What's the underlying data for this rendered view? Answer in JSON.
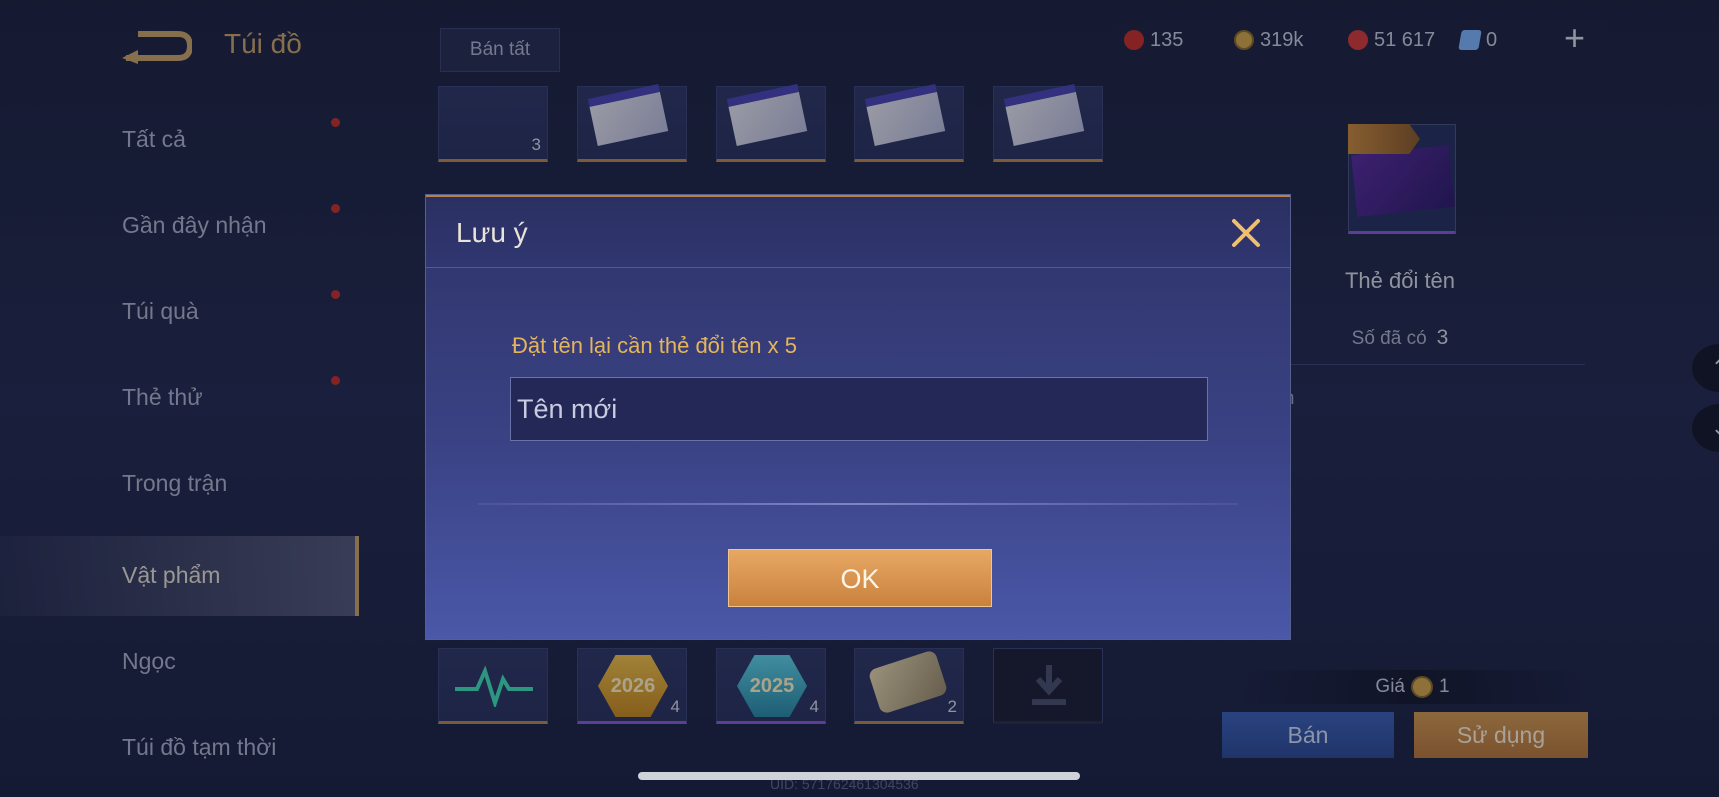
{
  "header": {
    "title": "Túi đồ",
    "sell_all_label": "Bán tất",
    "currencies": [
      {
        "icon": "red-gem-icon",
        "value": "135",
        "color": "#c8302c"
      },
      {
        "icon": "gold-coin-icon",
        "value": "319k",
        "color": "#d4a84a"
      },
      {
        "icon": "red-voucher-icon",
        "value": "51 617",
        "color": "#d63a3a"
      },
      {
        "icon": "blue-ticket-icon",
        "value": "0",
        "color": "#7fb6ff"
      }
    ],
    "plus_label": "+"
  },
  "sidebar": {
    "items": [
      {
        "label": "Tất cả",
        "has_dot": true
      },
      {
        "label": "Gần đây nhận",
        "has_dot": true
      },
      {
        "label": "Túi quà",
        "has_dot": true
      },
      {
        "label": "Thẻ thử",
        "has_dot": true
      },
      {
        "label": "Trong trận",
        "has_dot": false
      },
      {
        "label": "Vật phẩm",
        "has_dot": false,
        "active": true
      },
      {
        "label": "Ngọc",
        "has_dot": false
      },
      {
        "label": "Túi đồ tạm thời",
        "has_dot": false
      }
    ]
  },
  "grid": {
    "row1_first_qty": "3",
    "row_bottom": [
      {
        "name": "heartbeat-item",
        "qty": ""
      },
      {
        "name": "badge-2026",
        "label": "2026",
        "qty": "4"
      },
      {
        "name": "badge-2025",
        "label": "2025",
        "qty": "4"
      },
      {
        "name": "scroll-item",
        "qty": "2"
      },
      {
        "name": "download-slot",
        "qty": ""
      }
    ]
  },
  "detail": {
    "item_name": "Thẻ đổi tên",
    "owned_label": "Số đã có",
    "owned_value": "3",
    "desc_fragment": "tên",
    "price_label": "Giá",
    "price_value": "1",
    "sell_label": "Bán",
    "use_label": "Sử dụng"
  },
  "uid": "UID: 571762461304536",
  "modal": {
    "title": "Lưu ý",
    "message": "Đặt tên lại cần thẻ đổi tên x 5",
    "input_placeholder": "Tên mới",
    "ok_label": "OK"
  }
}
